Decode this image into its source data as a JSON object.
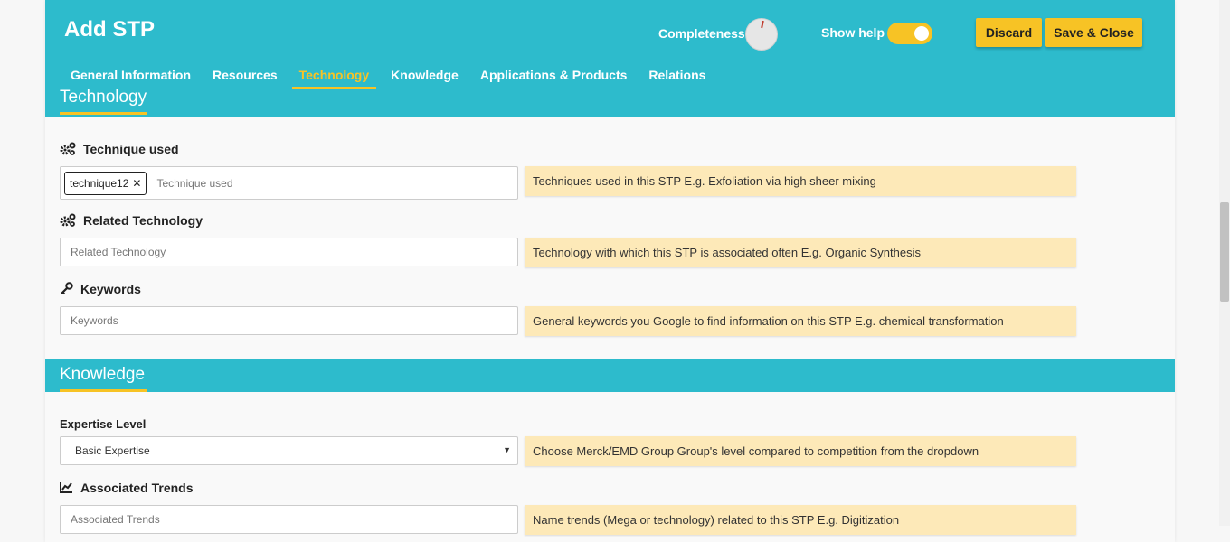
{
  "header": {
    "title": "Add STP",
    "completeness_label": "Completeness",
    "show_help_label": "Show help",
    "show_help_on": true,
    "discard_label": "Discard",
    "save_label": "Save & Close"
  },
  "tabs": [
    {
      "label": "General Information",
      "active": false
    },
    {
      "label": "Resources",
      "active": false
    },
    {
      "label": "Technology",
      "active": true
    },
    {
      "label": "Knowledge",
      "active": false
    },
    {
      "label": "Applications & Products",
      "active": false
    },
    {
      "label": "Relations",
      "active": false
    }
  ],
  "technology": {
    "section_title": "Technology",
    "technique": {
      "label": "Technique used",
      "icon": "gears-icon",
      "chip": "technique12",
      "placeholder": "Technique used",
      "hint": "Techniques used in this STP E.g. Exfoliation via high sheer mixing"
    },
    "related": {
      "label": "Related Technology",
      "icon": "gears-icon",
      "placeholder": "Related Technology",
      "hint": "Technology with which this STP is associated often E.g. Organic Synthesis"
    },
    "keywords": {
      "label": "Keywords",
      "icon": "key-icon",
      "placeholder": "Keywords",
      "hint": "General keywords you Google to find information on this STP E.g. chemical transformation"
    }
  },
  "knowledge": {
    "section_title": "Knowledge",
    "expertise": {
      "label": "Expertise Level",
      "selected": "Basic Expertise",
      "hint": "Choose Merck/EMD Group Group's level compared to competition from the dropdown"
    },
    "trends": {
      "label": "Associated Trends",
      "icon": "chart-line-icon",
      "placeholder": "Associated Trends",
      "hint": "Name trends (Mega or technology) related to this STP E.g. Digitization"
    }
  },
  "colors": {
    "header_bg": "#2dbbcc",
    "accent": "#f7c325",
    "hint_bg": "#fde9b8"
  }
}
